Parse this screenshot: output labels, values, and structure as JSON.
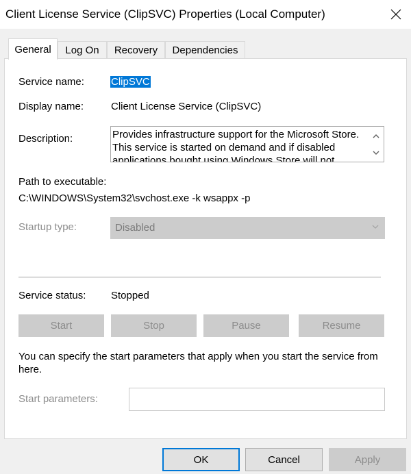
{
  "window": {
    "title": "Client License Service (ClipSVC) Properties (Local Computer)",
    "close_glyph": "✕"
  },
  "tabs": [
    {
      "label": "General",
      "active": true
    },
    {
      "label": "Log On",
      "active": false
    },
    {
      "label": "Recovery",
      "active": false
    },
    {
      "label": "Dependencies",
      "active": false
    }
  ],
  "general": {
    "service_name_label": "Service name:",
    "service_name_value": "ClipSVC",
    "display_name_label": "Display name:",
    "display_name_value": "Client License Service (ClipSVC)",
    "description_label": "Description:",
    "description_value": "Provides infrastructure support for the Microsoft Store. This service is started on demand and if disabled applications bought using Windows Store will not behave correctly.",
    "path_label": "Path to executable:",
    "path_value": "C:\\WINDOWS\\System32\\svchost.exe -k wsappx -p",
    "startup_type_label": "Startup type:",
    "startup_type_value": "Disabled",
    "service_status_label": "Service status:",
    "service_status_value": "Stopped",
    "control_buttons": {
      "start": "Start",
      "stop": "Stop",
      "pause": "Pause",
      "resume": "Resume"
    },
    "start_params_help": "You can specify the start parameters that apply when you start the service from here.",
    "start_params_label": "Start parameters:",
    "start_params_value": ""
  },
  "footer": {
    "ok": "OK",
    "cancel": "Cancel",
    "apply": "Apply"
  },
  "colors": {
    "accent": "#0078d7",
    "disabled_text": "#8c8c8c",
    "disabled_bg": "#cccccc",
    "dialog_bg": "#f0f0f0"
  }
}
